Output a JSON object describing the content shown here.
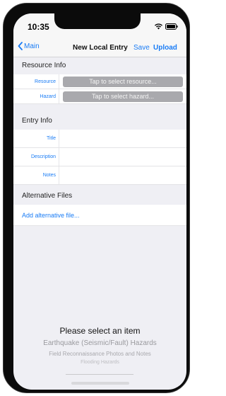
{
  "status_bar": {
    "time": "10:35",
    "icons": [
      "wifi-icon",
      "battery-icon"
    ]
  },
  "nav": {
    "back_label": "Main",
    "back_icon": "chevron-left-icon",
    "title": "New Local Entry",
    "save_label": "Save",
    "upload_label": "Upload"
  },
  "resource_info": {
    "header": "Resource Info",
    "rows": [
      {
        "label": "Resource",
        "button": "Tap to select resource..."
      },
      {
        "label": "Hazard",
        "button": "Tap to select hazard..."
      }
    ]
  },
  "entry_info": {
    "header": "Entry Info",
    "fields": [
      {
        "label": "Title",
        "value": ""
      },
      {
        "label": "Description",
        "value": ""
      },
      {
        "label": "Notes",
        "value": ""
      }
    ]
  },
  "alternative_files": {
    "header": "Alternative Files",
    "add_label": "Add alternative file..."
  },
  "picker": {
    "selected": "Please select an item",
    "options": [
      "Earthquake (Seismic/Fault) Hazards",
      "Field Reconnaissance Photos and Notes",
      "Flooding Hazards"
    ]
  },
  "colors": {
    "accent": "#1a7cf5",
    "background": "#efeff4",
    "button_gray": "#a9a9ad"
  }
}
